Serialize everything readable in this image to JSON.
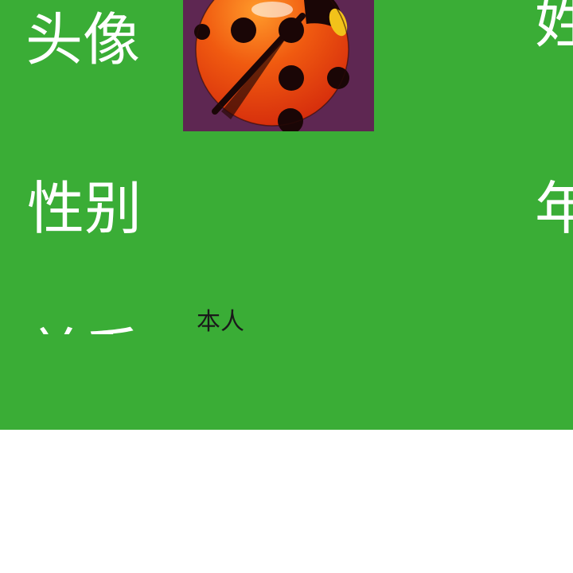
{
  "profile": {
    "avatar_label": "头像",
    "name_label": "姓",
    "gender_label": "性别",
    "age_label": "年",
    "relation_label": "关系",
    "relation_value": "本人",
    "avatar_icon": "ladybug-icon"
  },
  "colors": {
    "panel_background": "#3aad36",
    "avatar_background": "#5e2752",
    "label_text": "#ffffff",
    "value_text": "#1a1a1a"
  }
}
